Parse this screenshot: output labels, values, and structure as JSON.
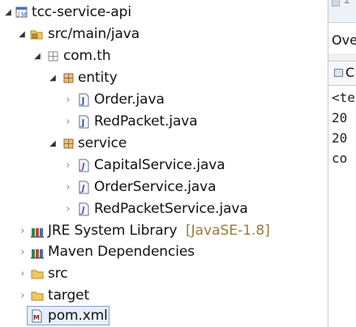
{
  "tree": {
    "project": {
      "label": "tcc-service-api"
    },
    "src_main_java": {
      "label": "src/main/java"
    },
    "package_root": {
      "label": "com.th"
    },
    "package_entity": {
      "label": "entity"
    },
    "file_order": {
      "label": "Order.java"
    },
    "file_redpacket": {
      "label": "RedPacket.java"
    },
    "package_service": {
      "label": "service"
    },
    "file_capital_service": {
      "label": "CapitalService.java"
    },
    "file_order_service": {
      "label": "OrderService.java"
    },
    "file_redpacket_service": {
      "label": "RedPacketService.java"
    },
    "jre_library": {
      "label": "JRE System Library",
      "decoration": "[JavaSE-1.8]"
    },
    "maven_deps": {
      "label": "Maven Dependencies"
    },
    "folder_src": {
      "label": "src"
    },
    "folder_target": {
      "label": "target"
    },
    "file_pom": {
      "label": "pom.xml"
    }
  },
  "side": {
    "top_text": "1",
    "overview_tab": "Ove",
    "console_tab": "C",
    "console_lines": [
      "<te",
      "20",
      "20",
      "co"
    ]
  },
  "colors": {
    "selection_bg": "#e6effa",
    "selection_border": "#7da2ce",
    "folder": "#e8b84b",
    "package": "#b07a2e",
    "java": "#3a5fa0",
    "decoration": "#9a7b3c"
  }
}
